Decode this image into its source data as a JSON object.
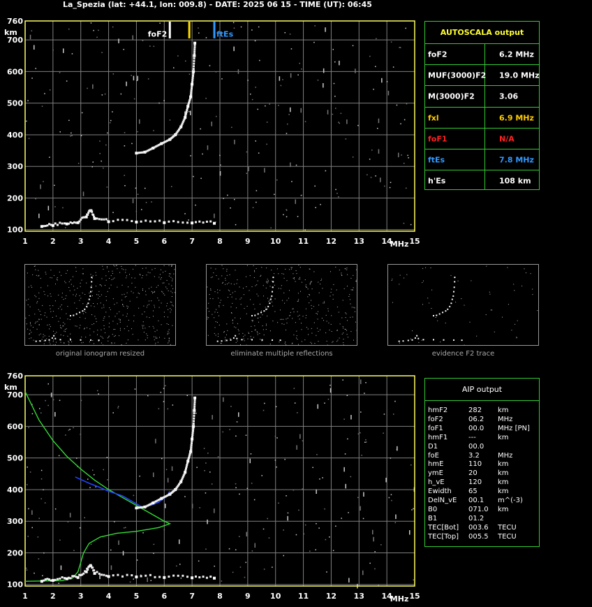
{
  "header": {
    "title": "La_Spezia (lat: +44.1, lon: 009.8) - DATE: 2025 06 15 - TIME (UT): 06:45"
  },
  "colors": {
    "axis": "#ffff66",
    "grid": "#808080",
    "table_border": "#33cc33",
    "fxl": "#ffcc00",
    "fof1": "#ff2222",
    "ftes": "#3399ff",
    "profile": "#33dd33",
    "fit": "#2244ff"
  },
  "autoscala": {
    "title": "AUTOSCALA output",
    "rows": [
      {
        "label": "foF2",
        "value": "6.2 MHz",
        "color": "#ffffff"
      },
      {
        "label": "MUF(3000)F2",
        "value": "19.0 MHz",
        "color": "#ffffff"
      },
      {
        "label": "M(3000)F2",
        "value": "3.06",
        "color": "#ffffff"
      },
      {
        "label": "fxl",
        "value": "6.9 MHz",
        "color": "#ffcc00"
      },
      {
        "label": "foF1",
        "value": "N/A",
        "color": "#ff2222"
      },
      {
        "label": "ftEs",
        "value": "7.8 MHz",
        "color": "#3399ff"
      },
      {
        "label": "h'Es",
        "value": "108     km",
        "color": "#ffffff"
      }
    ]
  },
  "aip": {
    "title": "AIP output",
    "rows": [
      {
        "label": "hmF2",
        "value": "282",
        "unit": "km"
      },
      {
        "label": "foF2",
        "value": "06.2",
        "unit": "MHz"
      },
      {
        "label": "foF1",
        "value": "00.0",
        "unit": "MHz   [PN]"
      },
      {
        "label": "hmF1",
        "value": "---",
        "unit": "km"
      },
      {
        "label": "D1",
        "value": "00.0",
        "unit": ""
      },
      {
        "label": "foE",
        "value": "3.2",
        "unit": "MHz"
      },
      {
        "label": "hmE",
        "value": "110",
        "unit": "km"
      },
      {
        "label": "ymE",
        "value": "20",
        "unit": "km"
      },
      {
        "label": "h_vE",
        "value": "120",
        "unit": "km"
      },
      {
        "label": "Ewidth",
        "value": "65",
        "unit": "km"
      },
      {
        "label": "DelN_vE",
        "value": "00.1",
        "unit": "m^(-3)"
      },
      {
        "label": "B0",
        "value": "071.0",
        "unit": "km"
      },
      {
        "label": "B1",
        "value": "01.2",
        "unit": ""
      },
      {
        "label": "TEC[Bot]",
        "value": "003.6",
        "unit": "TECU"
      },
      {
        "label": "TEC[Top]",
        "value": "005.5",
        "unit": "TECU"
      }
    ]
  },
  "thumbnails": [
    {
      "caption": "original ionogram resized"
    },
    {
      "caption": "eliminate multiple reflections"
    },
    {
      "caption": "evidence F2 trace"
    }
  ],
  "chart_data": [
    {
      "type": "scatter",
      "title": "",
      "xlabel": "MHz",
      "ylabel": "km",
      "xlim": [
        1,
        15
      ],
      "ylim": [
        95,
        760
      ],
      "xticks": [
        1,
        2,
        3,
        4,
        5,
        6,
        7,
        8,
        9,
        10,
        11,
        12,
        13,
        14,
        15
      ],
      "yticks": [
        100,
        200,
        300,
        400,
        500,
        600,
        700,
        760
      ],
      "grid": true,
      "markers": [
        {
          "label": "foF2",
          "x": 6.2,
          "color": "#ffffff"
        },
        {
          "label": "fxl",
          "x": 6.9,
          "color": "#ffdd00"
        },
        {
          "label": "ftEs",
          "x": 7.8,
          "color": "#3399ff"
        }
      ],
      "series": [
        {
          "trace": "F2",
          "points": [
            [
              5.0,
              342
            ],
            [
              5.3,
              345
            ],
            [
              5.6,
              358
            ],
            [
              5.9,
              372
            ],
            [
              6.2,
              385
            ],
            [
              6.4,
              400
            ],
            [
              6.6,
              425
            ],
            [
              6.75,
              455
            ],
            [
              6.85,
              490
            ],
            [
              6.95,
              520
            ],
            [
              7.0,
              560
            ],
            [
              7.05,
              600
            ],
            [
              7.08,
              650
            ],
            [
              7.1,
              690
            ]
          ]
        },
        {
          "trace": "Es",
          "points": [
            [
              1.6,
              110
            ],
            [
              2.0,
              113
            ],
            [
              2.5,
              118
            ],
            [
              2.9,
              122
            ],
            [
              3.2,
              140
            ],
            [
              3.35,
              160
            ],
            [
              3.5,
              135
            ],
            [
              4.0,
              125
            ],
            [
              5.0,
              124
            ],
            [
              6.0,
              122
            ],
            [
              7.0,
              121
            ],
            [
              7.8,
              120
            ]
          ]
        }
      ]
    },
    {
      "type": "line",
      "title": "",
      "xlabel": "MHz",
      "ylabel": "km",
      "xlim": [
        1,
        15
      ],
      "ylim": [
        95,
        760
      ],
      "xticks": [
        1,
        2,
        3,
        4,
        5,
        6,
        7,
        8,
        9,
        10,
        11,
        12,
        13,
        14,
        15
      ],
      "yticks": [
        100,
        200,
        300,
        400,
        500,
        600,
        700,
        760
      ],
      "grid": true,
      "series": [
        {
          "trace": "profile",
          "points": [
            [
              1.0,
              710
            ],
            [
              1.5,
              620
            ],
            [
              2.0,
              555
            ],
            [
              2.5,
              505
            ],
            [
              3.0,
              465
            ],
            [
              3.5,
              430
            ],
            [
              4.0,
              400
            ],
            [
              4.5,
              375
            ],
            [
              5.0,
              350
            ],
            [
              5.5,
              325
            ],
            [
              6.0,
              300
            ],
            [
              6.2,
              292
            ],
            [
              5.8,
              280
            ],
            [
              5.0,
              268
            ],
            [
              4.3,
              262
            ],
            [
              3.7,
              250
            ],
            [
              3.3,
              230
            ],
            [
              3.1,
              200
            ],
            [
              3.0,
              170
            ],
            [
              2.9,
              140
            ],
            [
              2.7,
              120
            ],
            [
              2.3,
              112
            ],
            [
              1.0,
              110
            ]
          ]
        },
        {
          "trace": "fit",
          "points": [
            [
              2.8,
              440
            ],
            [
              3.3,
              420
            ],
            [
              3.6,
              410
            ],
            [
              4.0,
              395
            ],
            [
              4.5,
              380
            ],
            [
              5.0,
              355
            ],
            [
              5.2,
              345
            ],
            [
              5.5,
              350
            ],
            [
              5.8,
              360
            ],
            [
              6.1,
              380
            ],
            [
              6.2,
              395
            ]
          ]
        },
        {
          "trace": "F2",
          "points": [
            [
              5.0,
              342
            ],
            [
              5.3,
              345
            ],
            [
              5.6,
              358
            ],
            [
              5.9,
              372
            ],
            [
              6.2,
              385
            ],
            [
              6.4,
              400
            ],
            [
              6.6,
              425
            ],
            [
              6.75,
              455
            ],
            [
              6.85,
              490
            ],
            [
              6.95,
              520
            ],
            [
              7.0,
              560
            ],
            [
              7.05,
              600
            ],
            [
              7.08,
              650
            ],
            [
              7.1,
              690
            ]
          ]
        },
        {
          "trace": "Es",
          "points": [
            [
              1.6,
              110
            ],
            [
              2.0,
              113
            ],
            [
              2.5,
              118
            ],
            [
              2.9,
              122
            ],
            [
              3.2,
              140
            ],
            [
              3.35,
              160
            ],
            [
              3.5,
              135
            ],
            [
              4.0,
              125
            ],
            [
              5.0,
              124
            ],
            [
              6.0,
              122
            ],
            [
              7.0,
              121
            ],
            [
              7.8,
              120
            ]
          ]
        }
      ]
    }
  ]
}
